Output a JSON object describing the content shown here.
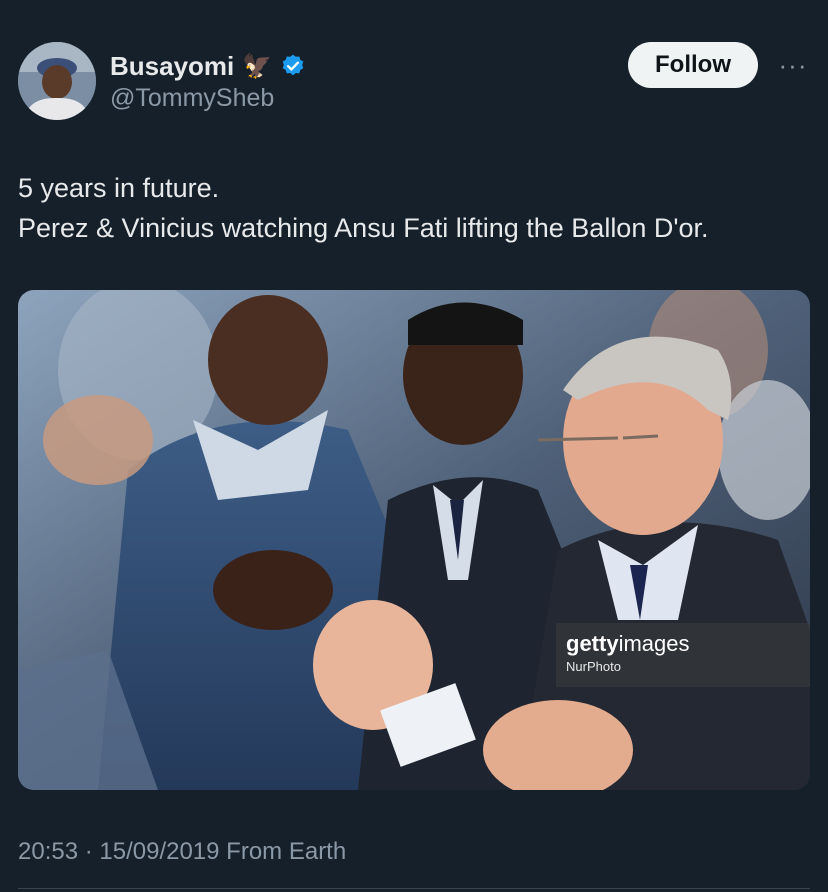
{
  "author": {
    "display_name": "Busayomi",
    "emoji": "🦅",
    "handle": "@TommySheb",
    "verified_icon": "verified-badge-icon"
  },
  "actions": {
    "follow_label": "Follow",
    "more_label": "···"
  },
  "tweet": {
    "lines": [
      "5 years in future.",
      "Perez & Vinicius watching Ansu Fati lifting the Ballon D'or."
    ]
  },
  "media": {
    "watermark_brand_bold": "getty",
    "watermark_brand_light": "images",
    "watermark_credit": "NurPhoto"
  },
  "footer": {
    "timestamp": "20:53 · 15/09/2019 From Earth"
  },
  "colors": {
    "background": "#15202b",
    "text": "#e7e9ea",
    "muted": "#8b98a5",
    "verified": "#1d9bf0",
    "follow_bg": "#eff3f4"
  }
}
